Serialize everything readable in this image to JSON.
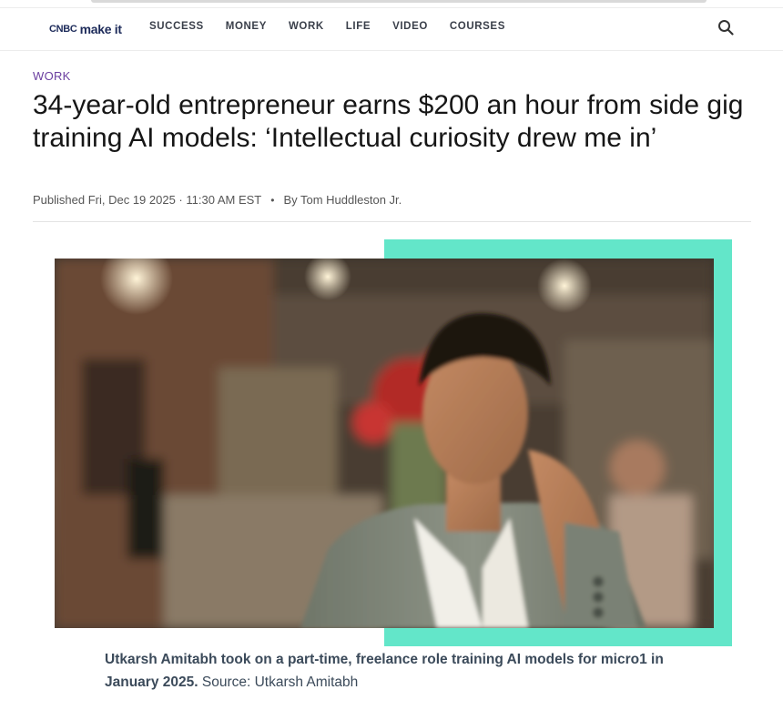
{
  "nav": {
    "logo": {
      "brand": "CNBC",
      "product": "make it"
    },
    "items": [
      "SUCCESS",
      "MONEY",
      "WORK",
      "LIFE",
      "VIDEO",
      "COURSES"
    ]
  },
  "article": {
    "section": "WORK",
    "headline": "34-year-old entrepreneur earns $200 an hour from side gig training AI models: ‘Intellectual curiosity drew me in’",
    "published": "Published Fri, Dec 19 2025 · 11:30 AM EST",
    "byline_sep": "•",
    "author": "By Tom Huddleston Jr.",
    "caption": {
      "main": "Utkarsh Amitabh took on a part-time, freelance role training AI models for micro1 in January 2025.",
      "source": "Source: Utkarsh Amitabh"
    }
  },
  "colors": {
    "brand_navy": "#1d2b5a",
    "section_purple": "#6b3fa0",
    "accent_teal": "#63e6c9"
  },
  "icons": {
    "search": "search-icon"
  }
}
